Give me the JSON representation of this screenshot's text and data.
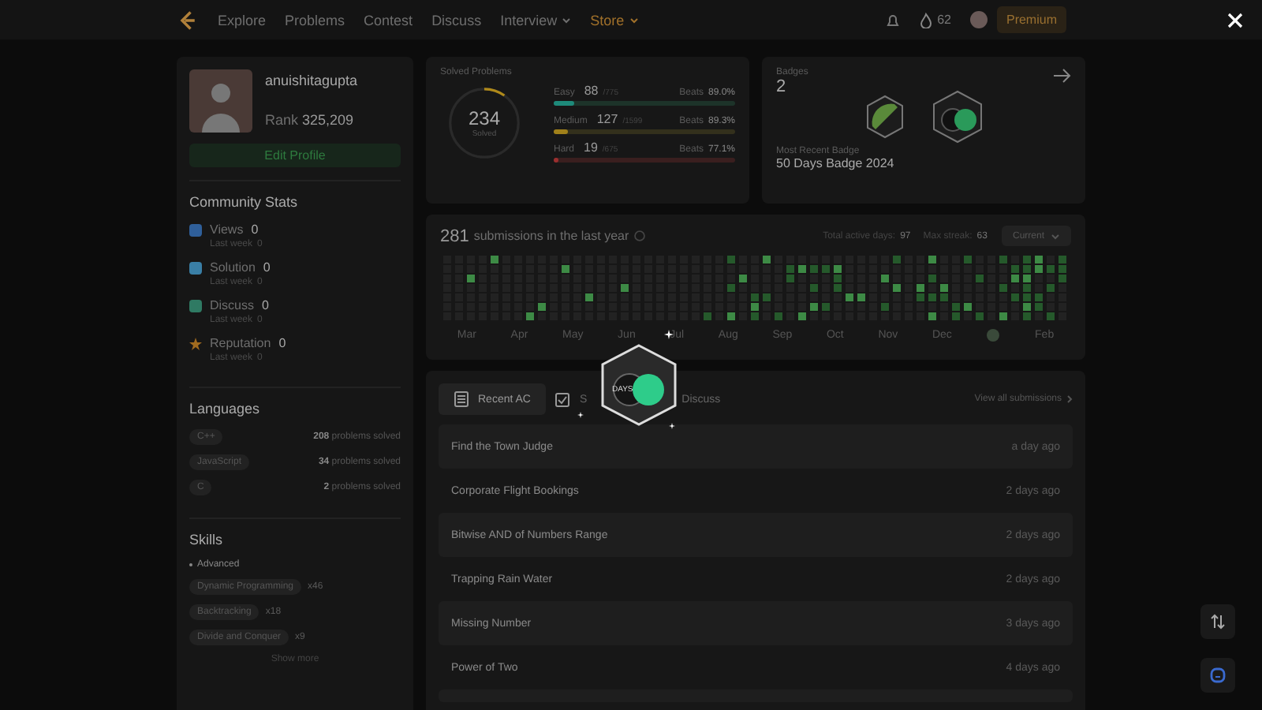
{
  "nav": {
    "links": [
      {
        "label": "Explore",
        "dropdown": false,
        "highlight": false
      },
      {
        "label": "Problems",
        "dropdown": false,
        "highlight": false
      },
      {
        "label": "Contest",
        "dropdown": false,
        "highlight": false
      },
      {
        "label": "Discuss",
        "dropdown": false,
        "highlight": false
      },
      {
        "label": "Interview",
        "dropdown": true,
        "highlight": false
      },
      {
        "label": "Store",
        "dropdown": true,
        "highlight": true
      }
    ],
    "streak": "62",
    "premium": "Premium"
  },
  "profile": {
    "username": "anuishitagupta",
    "rank_label": "Rank",
    "rank": "325,209",
    "edit": "Edit Profile"
  },
  "community": {
    "title": "Community Stats",
    "items": [
      {
        "kind": "views",
        "label": "Views",
        "value": "0",
        "sub": "Last week",
        "sub_value": "0"
      },
      {
        "kind": "solution",
        "label": "Solution",
        "value": "0",
        "sub": "Last week",
        "sub_value": "0"
      },
      {
        "kind": "discuss",
        "label": "Discuss",
        "value": "0",
        "sub": "Last week",
        "sub_value": "0"
      },
      {
        "kind": "reputation",
        "label": "Reputation",
        "value": "0",
        "sub": "Last week",
        "sub_value": "0"
      }
    ]
  },
  "languages": {
    "title": "Languages",
    "items": [
      {
        "name": "C++",
        "count": "208",
        "suffix": "problems solved"
      },
      {
        "name": "JavaScript",
        "count": "34",
        "suffix": "problems solved"
      },
      {
        "name": "C",
        "count": "2",
        "suffix": "problems solved"
      }
    ]
  },
  "skills": {
    "title": "Skills",
    "level": "Advanced",
    "items": [
      {
        "name": "Dynamic Programming",
        "count": "x46"
      },
      {
        "name": "Backtracking",
        "count": "x18"
      },
      {
        "name": "Divide and Conquer",
        "count": "x9"
      }
    ],
    "more": "Show more"
  },
  "solved": {
    "title": "Solved Problems",
    "total": "234",
    "total_label": "Solved",
    "level": 0.1,
    "rows": [
      {
        "kind": "easy",
        "label": "Easy",
        "solved": "88",
        "total": "/775",
        "beats_label": "Beats",
        "beats": "89.0%",
        "level": 0.114
      },
      {
        "kind": "medium",
        "label": "Medium",
        "solved": "127",
        "total": "/1599",
        "beats_label": "Beats",
        "beats": "89.3%",
        "level": 0.08
      },
      {
        "kind": "hard",
        "label": "Hard",
        "solved": "19",
        "total": "/675",
        "beats_label": "Beats",
        "beats": "77.1%",
        "level": 0.028
      }
    ]
  },
  "badges": {
    "title": "Badges",
    "count": "2",
    "recent_label": "Most Recent Badge",
    "recent": "50 Days Badge 2024"
  },
  "calendar": {
    "count": "281",
    "label": "submissions in the last year",
    "active_label": "Total active days:",
    "active": "97",
    "streak_label": "Max streak:",
    "streak": "63",
    "period": "Current",
    "months": [
      {
        "kind": "month",
        "label": "Mar"
      },
      {
        "kind": "month",
        "label": "Apr"
      },
      {
        "kind": "month",
        "label": "May"
      },
      {
        "kind": "month",
        "label": "Jun"
      },
      {
        "kind": "month",
        "label": "Jul"
      },
      {
        "kind": "month",
        "label": "Aug"
      },
      {
        "kind": "month",
        "label": "Sep"
      },
      {
        "kind": "month",
        "label": "Oct"
      },
      {
        "kind": "month",
        "label": "Nov"
      },
      {
        "kind": "month",
        "label": "Dec"
      },
      {
        "kind": "badge"
      },
      {
        "kind": "month",
        "label": "Feb"
      }
    ]
  },
  "tabs": [
    {
      "kind": "list",
      "label": "Recent AC",
      "selected": true
    },
    {
      "kind": "check",
      "label": "S",
      "selected": false
    },
    {
      "kind": "chat",
      "label": "Discuss",
      "selected": false
    }
  ],
  "view_all": "View all submissions",
  "submissions": [
    {
      "title": "Find the Town Judge",
      "time": "a day ago"
    },
    {
      "title": "Corporate Flight Bookings",
      "time": "2 days ago"
    },
    {
      "title": "Bitwise AND of Numbers Range",
      "time": "2 days ago"
    },
    {
      "title": "Trapping Rain Water",
      "time": "2 days ago"
    },
    {
      "title": "Missing Number",
      "time": "3 days ago"
    },
    {
      "title": "Power of Two",
      "time": "4 days ago"
    }
  ],
  "overlay_badge": {
    "label": "DAYS"
  }
}
